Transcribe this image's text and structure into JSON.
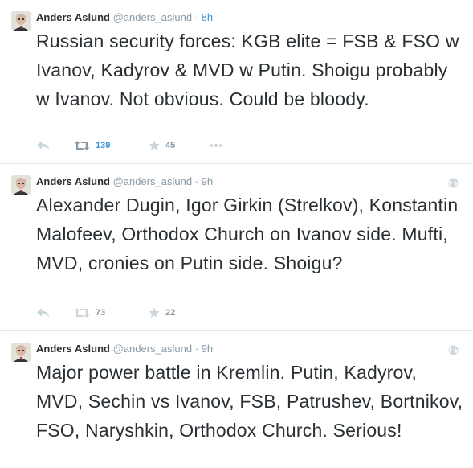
{
  "tweets": [
    {
      "author": "Anders Aslund",
      "handle": "@anders_aslund",
      "separator": "·",
      "time": "8h",
      "text": "Russian security forces: KGB elite = FSB & FSO w Ivanov, Kadyrov & MVD w Putin. Shoigu probably w Ivanov. Not obvious. Could be bloody.",
      "retweets": "139",
      "favorites": "45",
      "show_globe": false,
      "show_actions": true
    },
    {
      "author": "Anders Aslund",
      "handle": "@anders_aslund",
      "separator": "·",
      "time": "9h",
      "text": "Alexander Dugin, Igor Girkin (Strelkov), Konstantin Malofeev, Orthodox Church on Ivanov side. Mufti, MVD, cronies on Putin side. Shoigu?",
      "retweets": "73",
      "favorites": "22",
      "show_globe": true,
      "show_actions": true
    },
    {
      "author": "Anders Aslund",
      "handle": "@anders_aslund",
      "separator": "·",
      "time": "9h",
      "text": "Major power battle in Kremlin. Putin, Kadyrov, MVD, Sechin vs Ivanov, FSB, Patrushev, Bortnikov, FSO, Naryshkin, Orthodox Church. Serious!",
      "show_globe": true,
      "show_actions": false
    }
  ],
  "icons": {
    "reply": "reply-icon",
    "retweet": "retweet-icon",
    "favorite": "star-icon",
    "more": "more-dots-icon",
    "globe": "globe-icon"
  },
  "colors": {
    "text": "#292f33",
    "muted": "#8899a6",
    "link": "#3b94d9",
    "divider": "#e1e8ed"
  }
}
